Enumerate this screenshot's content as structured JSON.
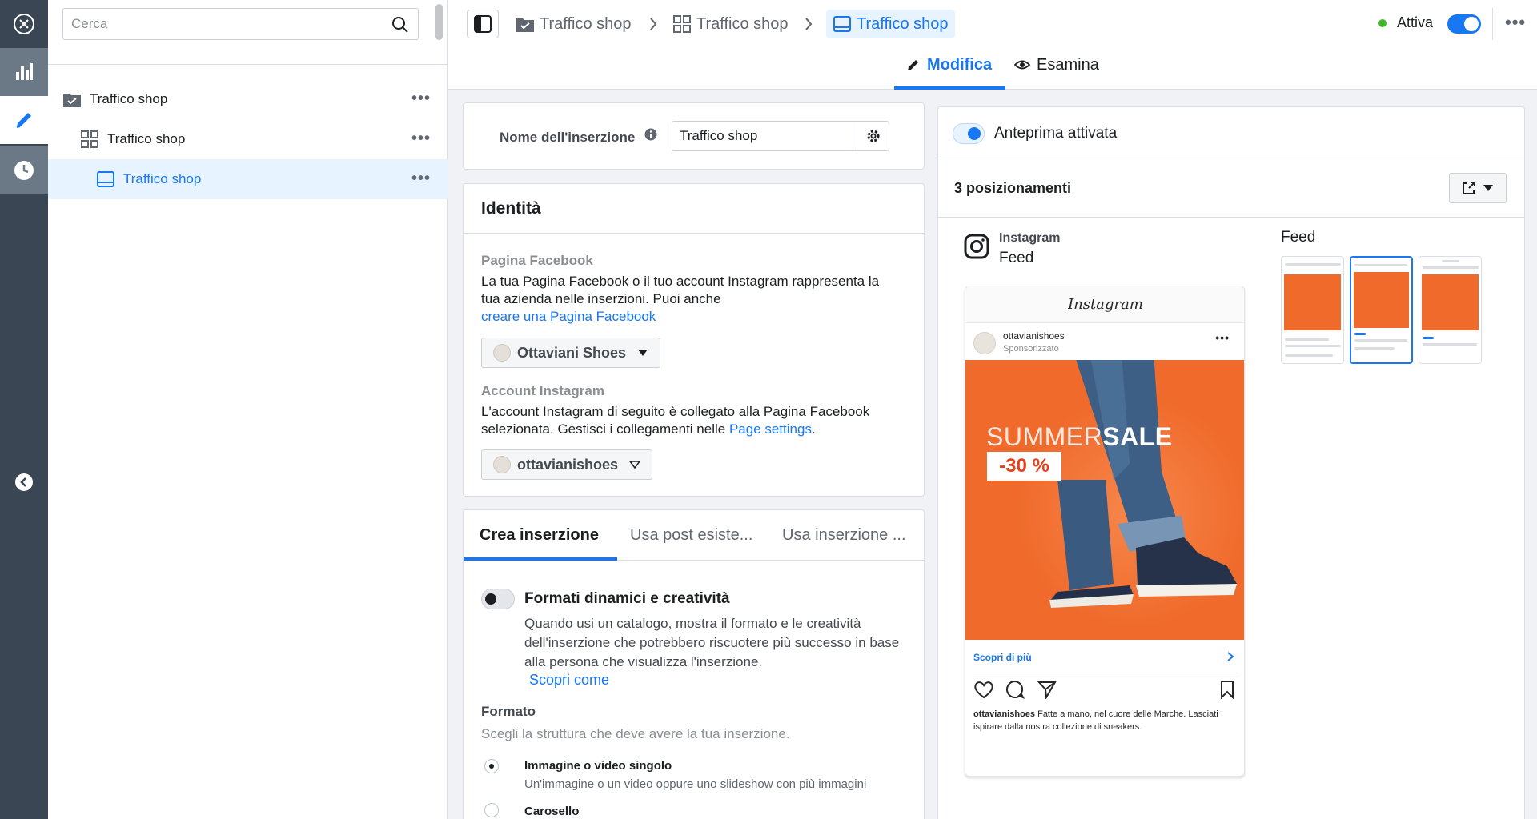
{
  "search": {
    "placeholder": "Cerca"
  },
  "tree": {
    "items": [
      {
        "label": "Traffico shop",
        "level": "campaign"
      },
      {
        "label": "Traffico shop",
        "level": "adset"
      },
      {
        "label": "Traffico shop",
        "level": "ad",
        "selected": true
      }
    ]
  },
  "breadcrumb": {
    "campaign": "Traffico shop",
    "adset": "Traffico shop",
    "ad": "Traffico shop"
  },
  "status": {
    "label": "Attiva",
    "color": "#42b72a",
    "on": true
  },
  "tabs": {
    "edit": "Modifica",
    "review": "Esamina"
  },
  "ad_name": {
    "label": "Nome dell'inserzione",
    "value": "Traffico shop"
  },
  "identity": {
    "title": "Identità",
    "fb_heading": "Pagina Facebook",
    "fb_desc": "La tua Pagina Facebook o il tuo account Instagram rappresenta la tua azienda nelle inserzioni. Puoi anche",
    "fb_link": "creare una Pagina Facebook",
    "fb_page": "Ottaviani Shoes",
    "ig_heading": "Account Instagram",
    "ig_desc": "L'account Instagram di seguito è collegato alla Pagina Facebook selezionata. Gestisci i collegamenti nelle",
    "ig_link": "Page settings",
    "ig_desc_end": ".",
    "ig_account": "ottavianishoes"
  },
  "create": {
    "tabs": [
      "Crea inserzione",
      "Usa post esiste...",
      "Usa inserzione ..."
    ],
    "dynamic_title": "Formati dinamici e creatività",
    "dynamic_desc": "Quando usi un catalogo, mostra il formato e le creatività dell'inserzione che potrebbero riscuotere più successo in base alla persona che visualizza l'inserzione.",
    "dynamic_link": "Scopri come",
    "format_heading": "Formato",
    "format_sub": "Scegli la struttura che deve avere la tua inserzione.",
    "options": [
      {
        "title": "Immagine o video singolo",
        "desc": "Un'immagine o un video oppure uno slideshow con più immagini",
        "selected": true
      },
      {
        "title": "Carosello",
        "desc": "",
        "selected": false
      }
    ]
  },
  "preview": {
    "toggle_label": "Anteprima attivata",
    "placements": "3 posizionamenti",
    "platform": "Instagram",
    "placement": "Feed",
    "group_label": "Feed",
    "post": {
      "logo": "Instagram",
      "username": "ottavianishoes",
      "sponsored": "Sponsorizzato",
      "headline_light": "SUMMER",
      "headline_bold": "SALE",
      "discount": "-30 %",
      "cta": "Scopri di più",
      "caption_user": "ottavianishoes",
      "caption": "Fatte a mano, nel cuore delle Marche. Lasciati ispirare dalla nostra collezione di sneakers."
    }
  },
  "colors": {
    "accent": "#1877f2",
    "rail": "#3a4653",
    "ad_bg": "#ef6a2b"
  }
}
